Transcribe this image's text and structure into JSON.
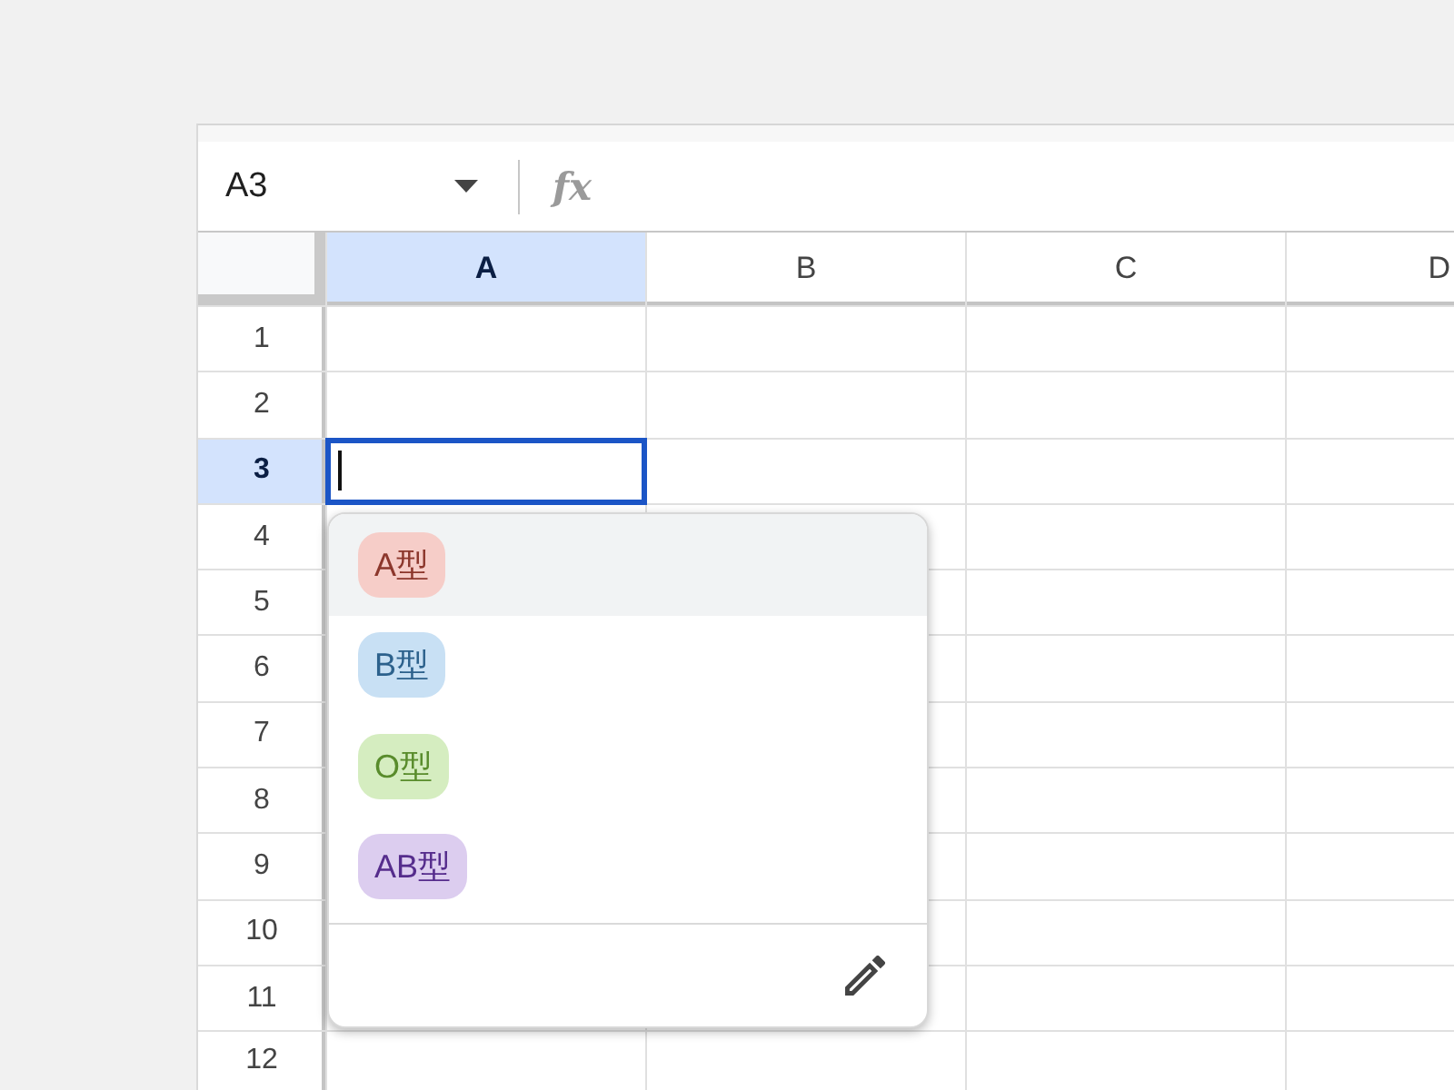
{
  "formula_bar": {
    "name_box": "A3",
    "function_label": "fx"
  },
  "sheet": {
    "columns": [
      {
        "label": "A",
        "selected": true
      },
      {
        "label": "B",
        "selected": false
      },
      {
        "label": "C",
        "selected": false
      },
      {
        "label": "D",
        "selected": false
      }
    ],
    "rows": [
      {
        "label": "1",
        "selected": false
      },
      {
        "label": "2",
        "selected": false
      },
      {
        "label": "3",
        "selected": true
      },
      {
        "label": "4",
        "selected": false
      },
      {
        "label": "5",
        "selected": false
      },
      {
        "label": "6",
        "selected": false
      },
      {
        "label": "7",
        "selected": false
      },
      {
        "label": "8",
        "selected": false
      },
      {
        "label": "9",
        "selected": false
      },
      {
        "label": "10",
        "selected": false
      },
      {
        "label": "11",
        "selected": false
      },
      {
        "label": "12",
        "selected": false
      }
    ]
  },
  "dropdown": {
    "options": [
      {
        "label": "A型",
        "color": "#f6cdc8",
        "selected": true
      },
      {
        "label": "B型",
        "color": "#c8e0f4",
        "selected": false
      },
      {
        "label": "O型",
        "color": "#d5edc0",
        "selected": false
      },
      {
        "label": "AB型",
        "color": "#dccdef",
        "selected": false
      }
    ]
  }
}
